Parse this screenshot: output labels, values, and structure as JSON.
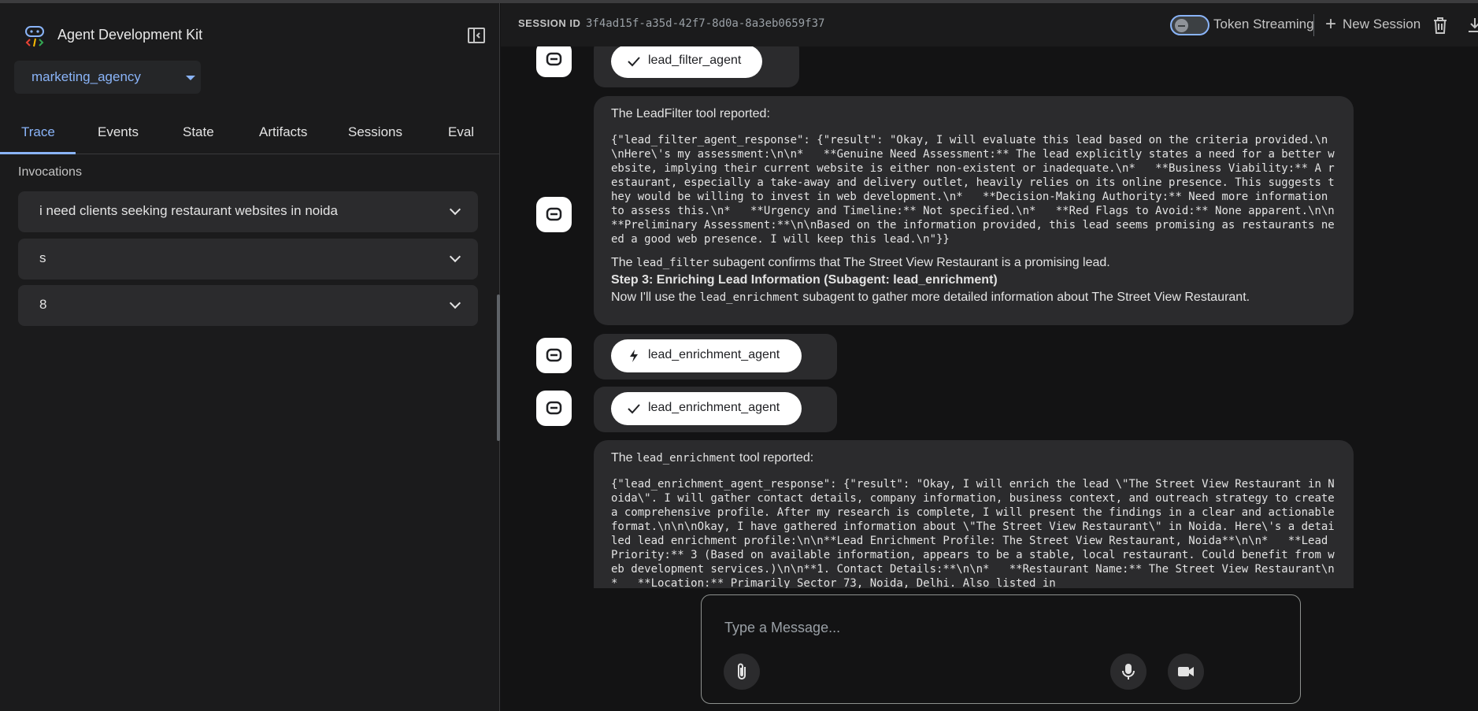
{
  "app": {
    "title": "Agent Development Kit"
  },
  "sidebar": {
    "agent_selected": "marketing_agency",
    "tabs": [
      {
        "label": "Trace"
      },
      {
        "label": "Events"
      },
      {
        "label": "State"
      },
      {
        "label": "Artifacts"
      },
      {
        "label": "Sessions"
      },
      {
        "label": "Eval"
      }
    ],
    "invocations_header": "Invocations",
    "invocations": [
      {
        "label": "i need clients seeking restaurant websites in noida"
      },
      {
        "label": "s"
      },
      {
        "label": "8"
      }
    ]
  },
  "header": {
    "session_label": "SESSION ID",
    "session_id": "3f4ad15f-a35d-42f7-8d0a-8a3eb0659f37",
    "token_streaming_label": "Token Streaming",
    "new_session_label": "New Session"
  },
  "chat": {
    "pill_top": "lead_filter_agent",
    "msg1": {
      "intro": "The LeadFilter tool reported:",
      "json": "{\"lead_filter_agent_response\": {\"result\": \"Okay, I will evaluate this lead based on the criteria provided.\\n\\nHere\\'s my assessment:\\n\\n*   **Genuine Need Assessment:** The lead explicitly states a need for a better website, implying their current website is either non-existent or inadequate.\\n*   **Business Viability:** A restaurant, especially a take-away and delivery outlet, heavily relies on its online presence. This suggests they would be willing to invest in web development.\\n*   **Decision-Making Authority:** Need more information to assess this.\\n*   **Urgency and Timeline:** Not specified.\\n*   **Red Flags to Avoid:** None apparent.\\n\\n**Preliminary Assessment:**\\n\\nBased on the information provided, this lead seems promising as restaurants need a good web presence. I will keep this lead.\\n\"}}",
      "confirm_pre": "The ",
      "confirm_code": "lead_filter",
      "confirm_post": " subagent confirms that The Street View Restaurant is a promising lead.",
      "step": "Step 3: Enriching Lead Information (Subagent: lead_enrichment)",
      "next_pre": "Now I'll use the ",
      "next_code": "lead_enrichment",
      "next_post": " subagent to gather more detailed information about The Street View Restaurant."
    },
    "pill_call": "lead_enrichment_agent",
    "pill_response": "lead_enrichment_agent",
    "msg2": {
      "intro_pre": "The ",
      "intro_code": "lead_enrichment",
      "intro_post": " tool reported:",
      "json": "{\"lead_enrichment_agent_response\": {\"result\": \"Okay, I will enrich the lead \\\"The Street View Restaurant in Noida\\\". I will gather contact details, company information, business context, and outreach strategy to create a comprehensive profile. After my research is complete, I will present the findings in a clear and actionable format.\\n\\n\\nOkay, I have gathered information about \\\"The Street View Restaurant\\\" in Noida. Here\\'s a detailed lead enrichment profile:\\n\\n**Lead Enrichment Profile: The Street View Restaurant, Noida**\\n\\n*   **Lead Priority:** 3 (Based on available information, appears to be a stable, local restaurant. Could benefit from web development services.)\\n\\n**1. Contact Details:**\\n\\n*   **Restaurant Name:** The Street View Restaurant\\n*   **Location:** Primarily Sector 73, Noida, Delhi. Also listed in"
    }
  },
  "input": {
    "placeholder": "Type a Message..."
  },
  "colors": {
    "accent": "#8ab4f8",
    "bubble": "#2b2b2d",
    "sidebar": "#1b1b1c",
    "background": "#131314"
  }
}
